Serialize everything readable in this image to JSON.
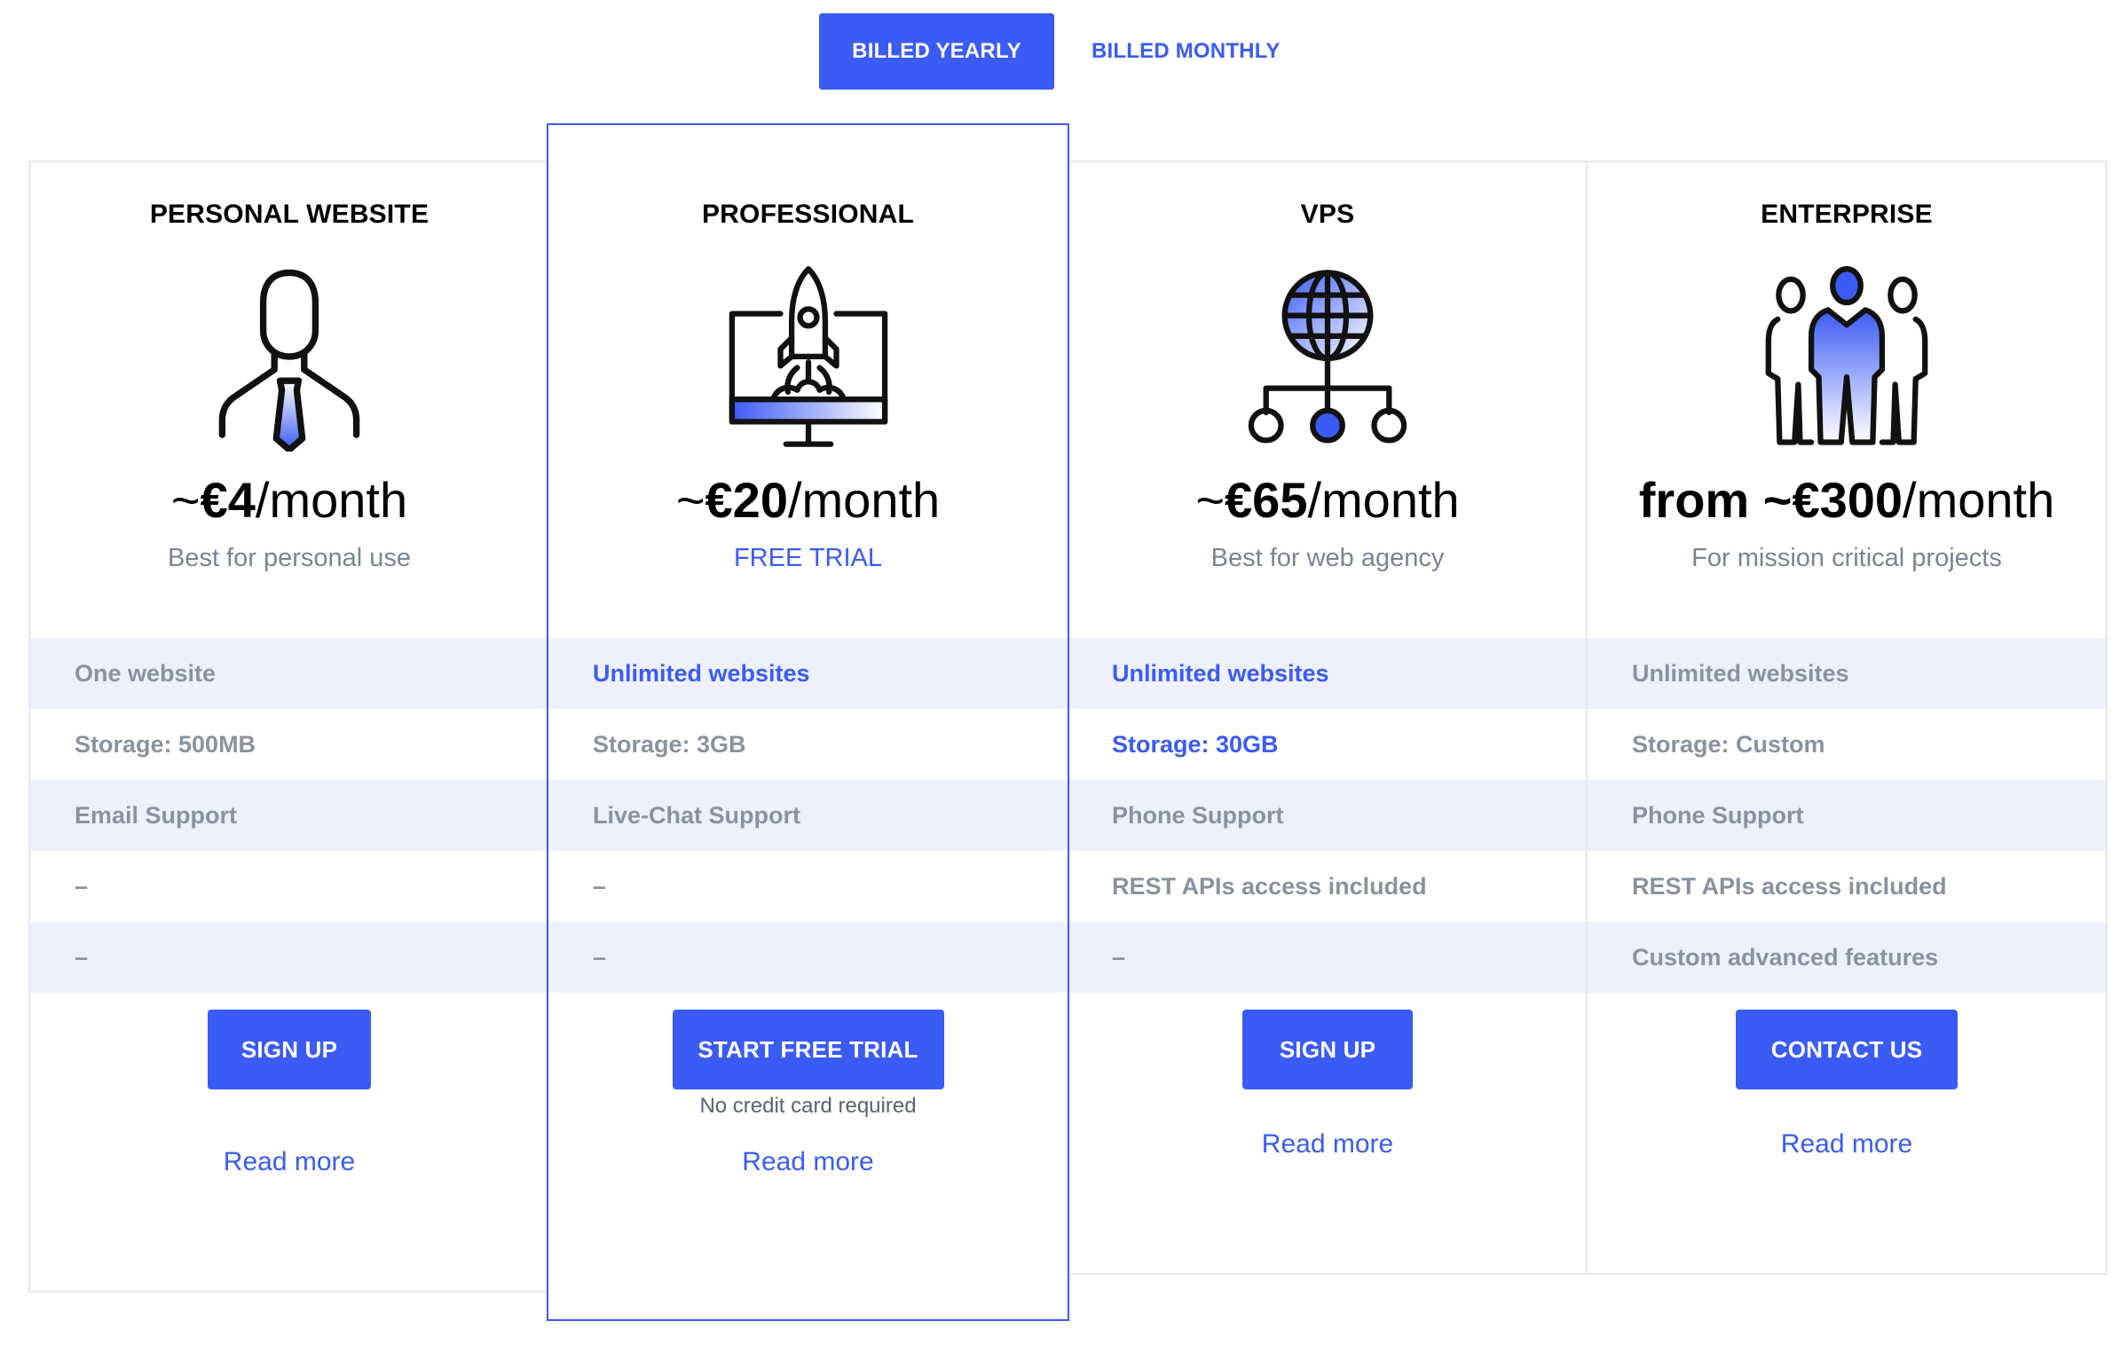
{
  "billing_toggle": {
    "yearly_label": "BILLED YEARLY",
    "monthly_label": "BILLED MONTHLY",
    "active": "yearly"
  },
  "colors": {
    "accent": "#3b5bf5",
    "row_alt_bg": "#eef1fd",
    "muted_text": "#8a92a0",
    "border": "#e6e8ee"
  },
  "plans": [
    {
      "title": "PERSONAL WEBSITE",
      "icon": "businessman-icon",
      "price_prefix": "~",
      "price_amount": "€4",
      "price_suffix": "/month",
      "subtitle": "Best for personal use",
      "features": [
        "One website",
        "Storage: 500MB",
        "Email Support",
        "–",
        "–"
      ],
      "cta_label": "SIGN UP",
      "read_more": "Read more"
    },
    {
      "title": "PROFESSIONAL",
      "icon": "rocket-monitor-icon",
      "price_prefix": "~",
      "price_amount": "€20",
      "price_suffix": "/month",
      "subtitle": "FREE TRIAL",
      "features": [
        "Unlimited websites",
        "Storage: 3GB",
        "Live-Chat Support",
        "–",
        "–"
      ],
      "cta_label": "START FREE TRIAL",
      "cta_note": "No credit card required",
      "read_more": "Read more"
    },
    {
      "title": "VPS",
      "icon": "globe-network-icon",
      "price_prefix": "~",
      "price_amount": "€65",
      "price_suffix": "/month",
      "subtitle": "Best for web agency",
      "features": [
        "Unlimited websites",
        "Storage: 30GB",
        "Phone Support",
        "REST APIs access included",
        "–"
      ],
      "cta_label": "SIGN UP",
      "read_more": "Read more"
    },
    {
      "title": "ENTERPRISE",
      "icon": "team-icon",
      "price_prefix": "from ~",
      "price_amount": "€300",
      "price_suffix": "/month",
      "subtitle": "For mission critical projects",
      "features": [
        "Unlimited websites",
        "Storage: Custom",
        "Phone Support",
        "REST APIs access included",
        "Custom advanced features"
      ],
      "cta_label": "CONTACT US",
      "read_more": "Read more"
    }
  ]
}
